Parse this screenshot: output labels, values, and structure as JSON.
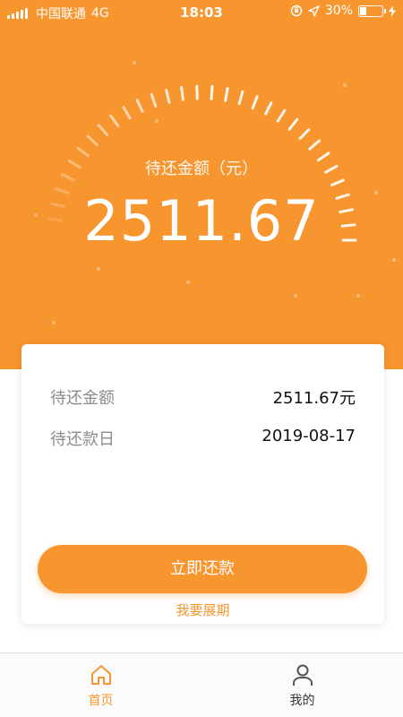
{
  "status_bar": {
    "carrier": "中国联通",
    "network": "4G",
    "time": "18:03",
    "battery_percent": "30%",
    "battery_level": 0.3,
    "icons": [
      "signal-icon",
      "rotation-lock-icon",
      "location-arrow-icon",
      "battery-icon",
      "charging-bolt-icon"
    ]
  },
  "hero": {
    "label": "待还金额（元）",
    "amount": "2511.67",
    "background_color": "#f7952f"
  },
  "details": {
    "rows": [
      {
        "label": "待还金额",
        "value": "2511.67元"
      },
      {
        "label": "待还款日",
        "value": "2019-08-17"
      }
    ]
  },
  "actions": {
    "pay_now": "立即还款",
    "extend": "我要展期"
  },
  "tabbar": {
    "items": [
      {
        "label": "首页",
        "icon": "home-icon",
        "active": true
      },
      {
        "label": "我的",
        "icon": "person-icon",
        "active": false
      }
    ],
    "active_color": "#f7952f"
  }
}
